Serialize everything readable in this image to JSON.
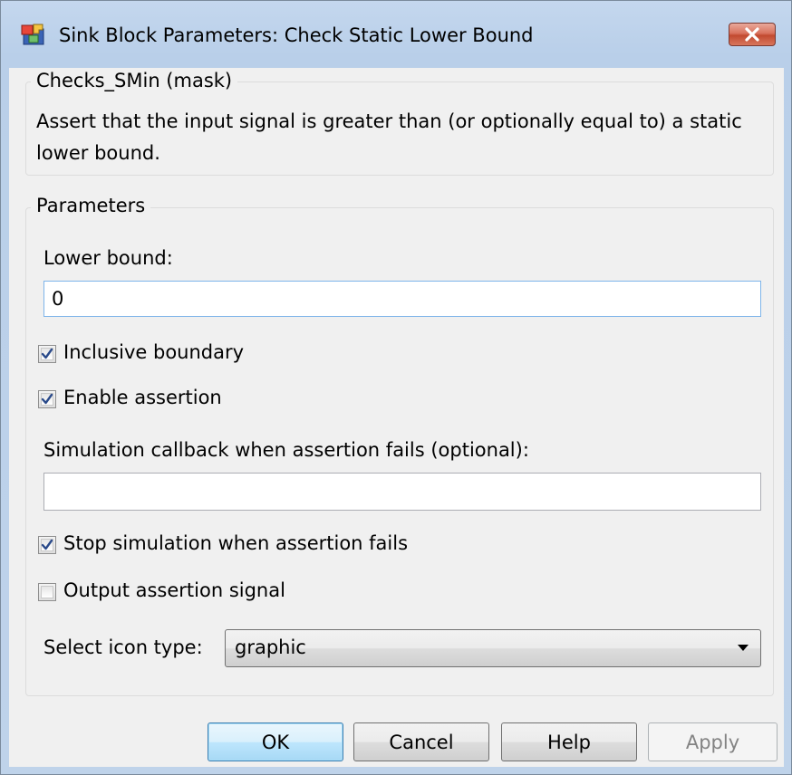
{
  "window": {
    "title": "Sink Block Parameters: Check Static Lower Bound",
    "icon": "simulink-block-icon",
    "close_icon": "close-icon"
  },
  "description_group": {
    "legend": "Checks_SMin (mask)",
    "text": "Assert that the input signal is greater than (or optionally equal to) a static lower bound."
  },
  "parameters_group": {
    "legend": "Parameters",
    "lower_bound_label": "Lower bound:",
    "lower_bound_value": "0",
    "inclusive_boundary": {
      "label": "Inclusive boundary",
      "checked": true
    },
    "enable_assertion": {
      "label": "Enable assertion",
      "checked": true
    },
    "callback_label": "Simulation callback when assertion fails (optional):",
    "callback_value": "",
    "stop_simulation": {
      "label": "Stop simulation when assertion fails",
      "checked": true
    },
    "output_assertion": {
      "label": "Output assertion signal",
      "checked": false
    },
    "icon_type_label": "Select icon type:",
    "icon_type_value": "graphic"
  },
  "buttons": {
    "ok": "OK",
    "cancel": "Cancel",
    "help": "Help",
    "apply": "Apply"
  },
  "colors": {
    "title_bar": "#bfd3ea",
    "client_bg": "#f0f0f0",
    "close_button": "#c24a30",
    "check_mark": "#2a4a8a"
  }
}
